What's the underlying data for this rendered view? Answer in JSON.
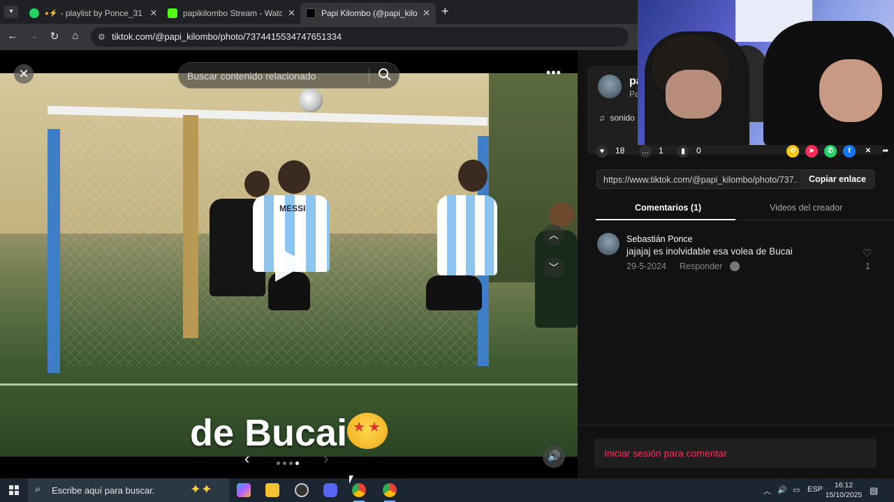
{
  "browser": {
    "tabs": [
      {
        "title": "- playlist by Ponce_31",
        "favicon_color": "#1ed760",
        "icon": "spotify-icon"
      },
      {
        "title": "papikilombo Stream - Watch Li",
        "favicon_color": "#53fc18",
        "icon": "kick-icon"
      },
      {
        "title": "Papi Kilombo (@papi_kilombo)",
        "favicon_color": "#000000",
        "icon": "tiktok-icon"
      }
    ],
    "url": "tiktok.com/@papi_kilombo/photo/7374415534747651334"
  },
  "viewer": {
    "search_placeholder": "Buscar contenido relacionado",
    "caption": "de Bucai",
    "jersey_text": "MESSI"
  },
  "panel": {
    "username": "pa",
    "nickname": "Pa",
    "music": "sonido",
    "likes": "18",
    "comments_count": "1",
    "saves": "0",
    "link": "https://www.tiktok.com/@papi_kilombo/photo/737...",
    "copy_label": "Copiar enlace",
    "tab_comments": "Comentarios (1)",
    "tab_videos": "Videos del creador",
    "comment": {
      "author": "Sebastián Ponce",
      "text": "jajajaj es inolvidable esa volea de Bucai",
      "date": "29-5-2024",
      "reply": "Responder",
      "likes": "1"
    },
    "login_label": "Iniciar sesión para comentar"
  },
  "taskbar": {
    "search_placeholder": "Escribe aquí para buscar.",
    "language": "ESP",
    "time": "16:12",
    "date": "15/10/2025"
  },
  "colors": {
    "accent_red": "#fe2c55",
    "panel_bg": "#121212"
  }
}
